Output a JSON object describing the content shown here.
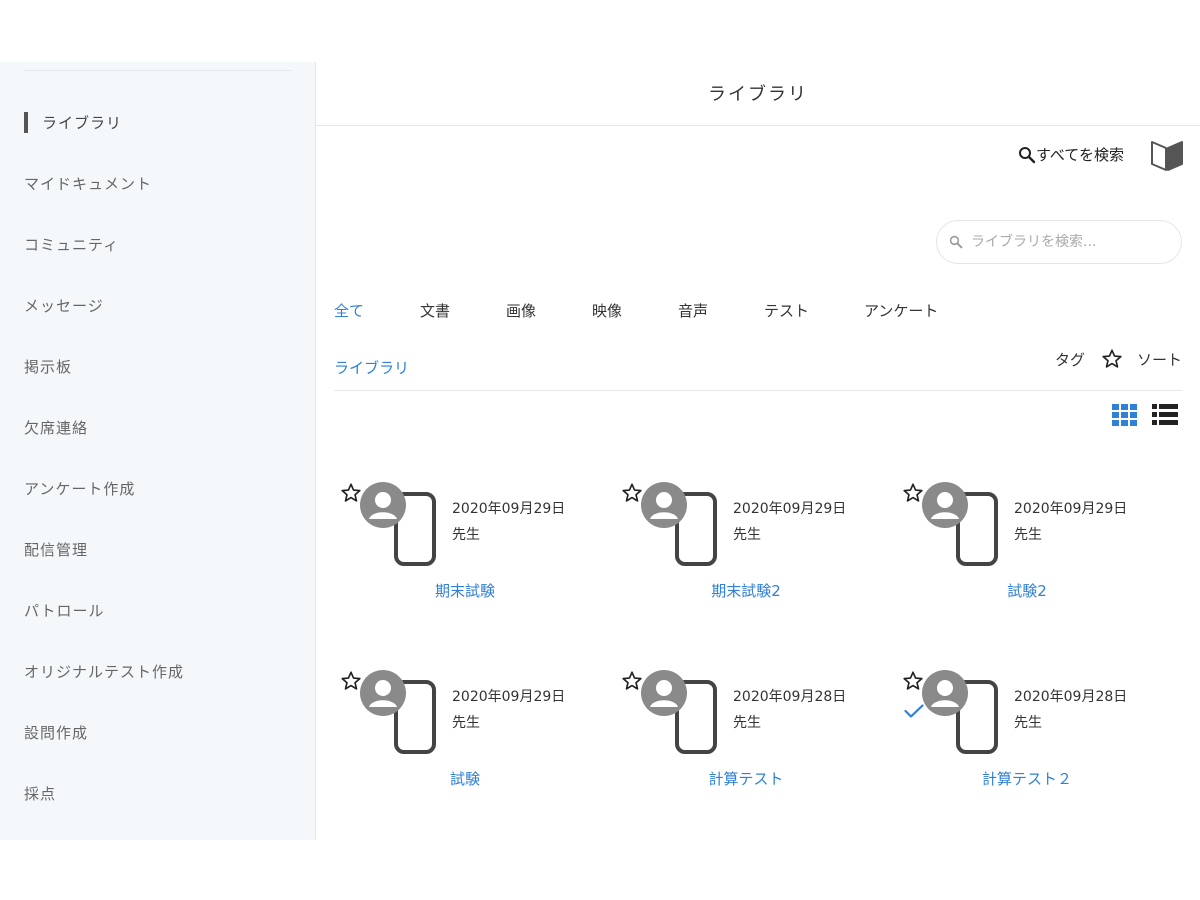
{
  "sidebar": {
    "items": [
      {
        "label": "ライブラリ",
        "active": true
      },
      {
        "label": "マイドキュメント"
      },
      {
        "label": "コミュニティ"
      },
      {
        "label": "メッセージ"
      },
      {
        "label": "掲示板"
      },
      {
        "label": "欠席連絡"
      },
      {
        "label": "アンケート作成"
      },
      {
        "label": "配信管理"
      },
      {
        "label": "パトロール"
      },
      {
        "label": "オリジナルテスト作成"
      },
      {
        "label": "設問作成"
      },
      {
        "label": "採点"
      }
    ]
  },
  "header": {
    "title": "ライブラリ"
  },
  "toolbar": {
    "search_all_label": "すべてを検索",
    "library_search_placeholder": "ライブラリを検索..."
  },
  "tabs": [
    {
      "label": "全て",
      "active": true
    },
    {
      "label": "文書"
    },
    {
      "label": "画像"
    },
    {
      "label": "映像"
    },
    {
      "label": "音声"
    },
    {
      "label": "テスト"
    },
    {
      "label": "アンケート"
    }
  ],
  "breadcrumb": "ライブラリ",
  "tools": {
    "tag_label": "タグ",
    "sort_label": "ソート"
  },
  "colors": {
    "accent": "#2f80d6",
    "sidebar_bg": "#f5f8fb",
    "icon_gray": "#8a8a8a",
    "icon_dark": "#444444"
  },
  "items": [
    {
      "date": "2020年09月29日",
      "author": "先生",
      "title": "期末試験",
      "checked": false
    },
    {
      "date": "2020年09月29日",
      "author": "先生",
      "title": "期末試験2",
      "checked": false
    },
    {
      "date": "2020年09月29日",
      "author": "先生",
      "title": "試験2",
      "checked": false
    },
    {
      "date": "2020年09月29日",
      "author": "先生",
      "title": "試験",
      "checked": false
    },
    {
      "date": "2020年09月28日",
      "author": "先生",
      "title": "計算テスト",
      "checked": false
    },
    {
      "date": "2020年09月28日",
      "author": "先生",
      "title": "計算テスト２",
      "checked": true
    }
  ]
}
